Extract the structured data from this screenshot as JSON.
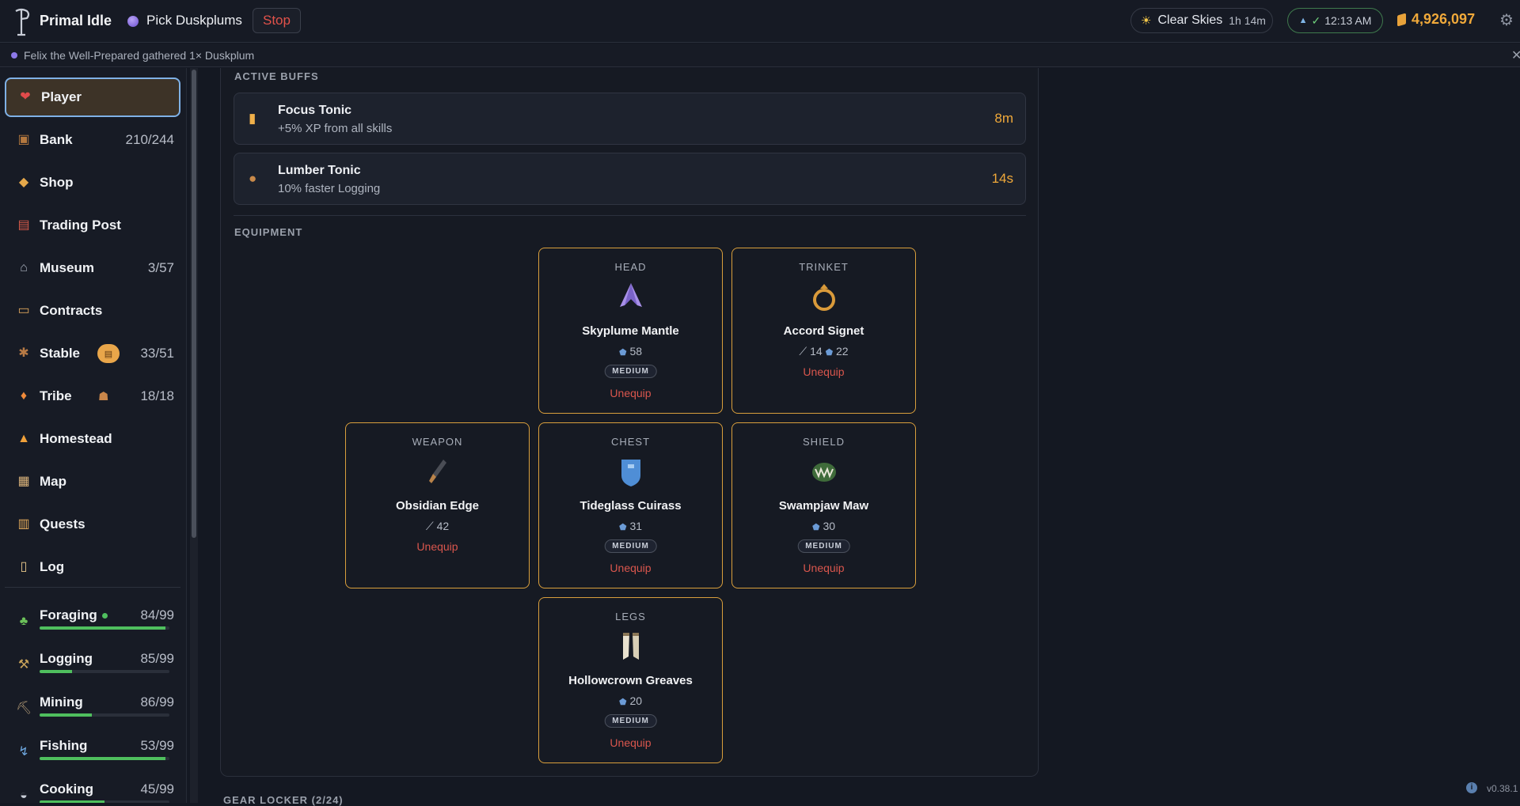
{
  "topbar": {
    "app_name": "Primal Idle",
    "task": "Pick Duskplums",
    "stop_label": "Stop",
    "weather": "Clear Skies",
    "weather_duration": "1h 14m",
    "clock": "12:13 AM",
    "gold": "4,926,097"
  },
  "notification": {
    "text": "Felix the Well-Prepared gathered 1× Duskplum"
  },
  "sidebar": {
    "items": [
      {
        "label": "Player",
        "icon": "heart-icon",
        "count": ""
      },
      {
        "label": "Bank",
        "icon": "chest-icon",
        "count": "210/244"
      },
      {
        "label": "Shop",
        "icon": "box-icon",
        "count": ""
      },
      {
        "label": "Trading Post",
        "icon": "stall-icon",
        "count": ""
      },
      {
        "label": "Museum",
        "icon": "museum-icon",
        "count": "3/57"
      },
      {
        "label": "Contracts",
        "icon": "sign-icon",
        "count": ""
      },
      {
        "label": "Stable",
        "icon": "paw-icon",
        "count": "33/51"
      },
      {
        "label": "Tribe",
        "icon": "flame-icon",
        "count": "18/18"
      },
      {
        "label": "Homestead",
        "icon": "tent-icon",
        "count": ""
      },
      {
        "label": "Map",
        "icon": "map-icon",
        "count": ""
      },
      {
        "label": "Quests",
        "icon": "clipboard-icon",
        "count": ""
      },
      {
        "label": "Log",
        "icon": "scroll-icon",
        "count": ""
      }
    ],
    "skills": [
      {
        "label": "Foraging",
        "icon": "sprout-icon",
        "count": "84/99",
        "progress": 0.97
      },
      {
        "label": "Logging",
        "icon": "axe-icon",
        "count": "85/99",
        "progress": 0.25
      },
      {
        "label": "Mining",
        "icon": "pickaxe-icon",
        "count": "86/99",
        "progress": 0.4
      },
      {
        "label": "Fishing",
        "icon": "fishing-rod-icon",
        "count": "53/99",
        "progress": 0.97
      },
      {
        "label": "Cooking",
        "icon": "pot-icon",
        "count": "45/99",
        "progress": 0.5
      }
    ]
  },
  "buffs": {
    "title": "ACTIVE BUFFS",
    "items": [
      {
        "name": "Focus Tonic",
        "desc": "+5% XP from all skills",
        "time": "8m",
        "icon": "bottle-icon"
      },
      {
        "name": "Lumber Tonic",
        "desc": "10% faster Logging",
        "time": "14s",
        "icon": "flask-icon"
      }
    ]
  },
  "equipment": {
    "title": "EQUIPMENT",
    "unequip_label": "Unequip",
    "slots": {
      "head": {
        "type": "HEAD",
        "name": "Skyplume Mantle",
        "defense": "58",
        "weight": "MEDIUM"
      },
      "trinket": {
        "type": "TRINKET",
        "name": "Accord Signet",
        "attack": "14",
        "defense": "22"
      },
      "weapon": {
        "type": "WEAPON",
        "name": "Obsidian Edge",
        "attack": "42"
      },
      "chest": {
        "type": "CHEST",
        "name": "Tideglass Cuirass",
        "defense": "31",
        "weight": "MEDIUM"
      },
      "shield": {
        "type": "SHIELD",
        "name": "Swampjaw Maw",
        "defense": "30",
        "weight": "MEDIUM"
      },
      "legs": {
        "type": "LEGS",
        "name": "Hollowcrown Greaves",
        "defense": "20",
        "weight": "MEDIUM"
      }
    }
  },
  "footer": {
    "locker": "GEAR LOCKER (2/24)",
    "version": "v0.38.1"
  },
  "colors": {
    "accent_gold": "#f0a93a",
    "danger": "#e2524a",
    "progress": "#4fbf5e",
    "slot_border": "#d99f3c"
  }
}
